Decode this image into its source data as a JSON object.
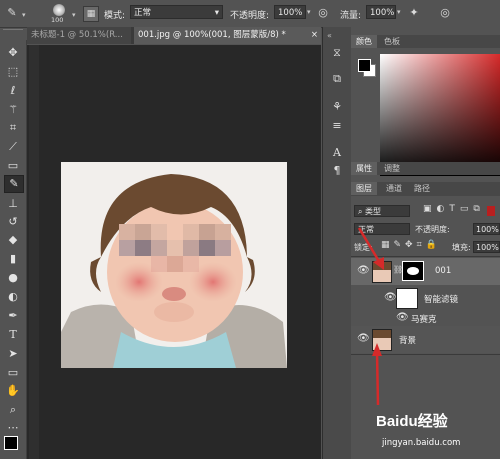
{
  "options_bar": {
    "brush_size": "100",
    "mode_label": "模式:",
    "mode_value": "正常",
    "opacity_label": "不透明度:",
    "opacity_value": "100%",
    "flow_label": "流量:",
    "flow_value": "100%"
  },
  "document_tabs": [
    {
      "label": "未标题-1 @ 50.1%(R...",
      "active": false
    },
    {
      "label": "001.jpg @ 100%(001, 图层蒙版/8) *",
      "active": true
    }
  ],
  "color_panel": {
    "tabs": [
      "颜色",
      "色板"
    ],
    "accent": "#d62a2a"
  },
  "properties_tabs": [
    "属性",
    "调整"
  ],
  "layers_panel": {
    "tabs": [
      "图层",
      "通道",
      "路径"
    ],
    "filter_kind": "类型",
    "blend_mode": "正常",
    "opacity_label": "不透明度:",
    "opacity_value": "100%",
    "lock_label": "锁定:",
    "fill_label": "填充:",
    "fill_value": "100%",
    "layers": [
      {
        "name": "001"
      },
      {
        "name": "智能滤镜"
      },
      {
        "name": "马赛克"
      },
      {
        "name": "背景"
      }
    ]
  },
  "watermark": {
    "brand": "Baidu经验",
    "url": "jingyan.baidu.com"
  },
  "icons": [
    "brush-icon",
    "move-icon",
    "marquee-icon",
    "lasso-icon",
    "magic-wand-icon",
    "crop-icon",
    "eyedropper-icon",
    "healing-icon",
    "brush-tool-icon",
    "stamp-icon",
    "history-brush-icon",
    "eraser-icon",
    "gradient-icon",
    "blur-icon",
    "dodge-icon",
    "pen-icon",
    "type-icon",
    "path-select-icon",
    "rectangle-icon",
    "hand-icon",
    "zoom-icon",
    "eye-icon",
    "link-icon"
  ]
}
